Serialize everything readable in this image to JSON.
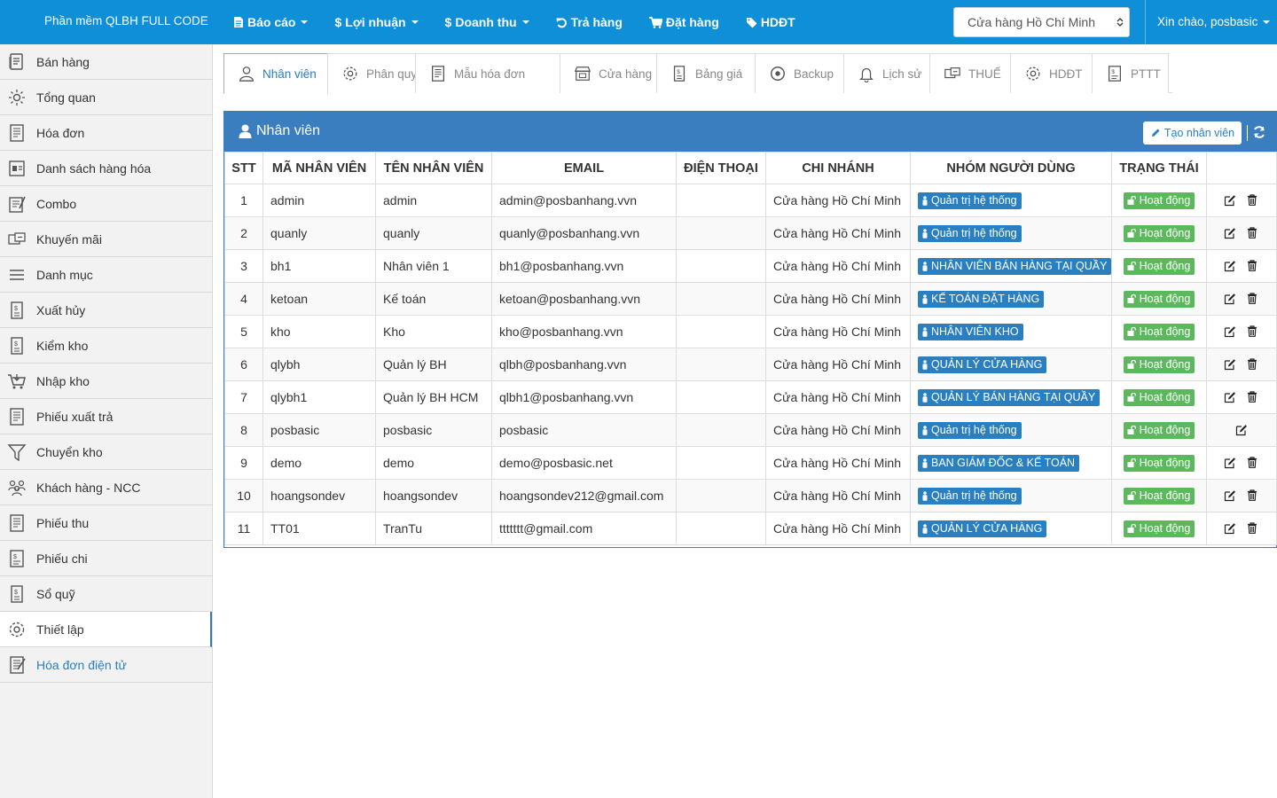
{
  "app": {
    "brand": "Phần mềm QLBH FULL CODE"
  },
  "topmenu": [
    {
      "icon": "file-text-icon",
      "label": "Báo cáo",
      "dropdown": true
    },
    {
      "icon": "dollar-icon",
      "label": "Lợi nhuận",
      "dropdown": true
    },
    {
      "icon": "dollar-icon",
      "label": "Doanh thu",
      "dropdown": true
    },
    {
      "icon": "undo-icon",
      "label": "Trả hàng",
      "dropdown": false
    },
    {
      "icon": "cart-icon",
      "label": "Đặt hàng",
      "dropdown": false
    },
    {
      "icon": "tag-icon",
      "label": "HDĐT",
      "dropdown": false
    }
  ],
  "store_select": {
    "value": "Cửa hàng Hồ Chí Minh"
  },
  "user": {
    "greeting": "Xin chào, posbasic"
  },
  "sidebar": [
    {
      "label": "Bán hàng",
      "icon": "sales-icon"
    },
    {
      "label": "Tổng quan",
      "icon": "dashboard-icon"
    },
    {
      "label": "Hóa đơn",
      "icon": "invoice-icon"
    },
    {
      "label": "Danh sách hàng hóa",
      "icon": "product-list-icon"
    },
    {
      "label": "Combo",
      "icon": "combo-icon"
    },
    {
      "label": "Khuyến mãi",
      "icon": "promotion-icon"
    },
    {
      "label": "Danh mục",
      "icon": "list-icon"
    },
    {
      "label": "Xuất hủy",
      "icon": "dispose-icon"
    },
    {
      "label": "Kiểm kho",
      "icon": "stock-check-icon"
    },
    {
      "label": "Nhập kho",
      "icon": "cart-in-icon"
    },
    {
      "label": "Phiếu xuất trả",
      "icon": "return-slip-icon"
    },
    {
      "label": "Chuyển kho",
      "icon": "filter-icon"
    },
    {
      "label": "Khách hàng - NCC",
      "icon": "customers-icon"
    },
    {
      "label": "Phiếu thu",
      "icon": "receipt-icon"
    },
    {
      "label": "Phiếu chi",
      "icon": "payment-icon"
    },
    {
      "label": "Sổ quỹ",
      "icon": "cashbook-icon"
    },
    {
      "label": "Thiết lập",
      "icon": "gear-icon",
      "active": true
    },
    {
      "label": "Hóa đơn điện tử",
      "icon": "e-invoice-icon",
      "link": true
    }
  ],
  "tabs": [
    {
      "label": "Nhân viên",
      "icon": "user-icon",
      "active": true,
      "width": 118
    },
    {
      "label": "Phân quyền",
      "icon": "gear-icon",
      "width": 100
    },
    {
      "label": "Mẫu hóa đơn",
      "icon": "invoice-icon",
      "width": 164
    },
    {
      "label": "Cửa hàng",
      "icon": "store-icon",
      "width": 110
    },
    {
      "label": "Bảng giá",
      "icon": "price-icon",
      "width": 112
    },
    {
      "label": "Backup",
      "icon": "backup-icon",
      "width": 101
    },
    {
      "label": "Lịch sử",
      "icon": "bell-icon",
      "width": 98
    },
    {
      "label": "THUẾ",
      "icon": "tax-icon",
      "width": 92
    },
    {
      "label": "HDĐT",
      "icon": "gear-icon",
      "width": 93
    },
    {
      "label": "PTTT",
      "icon": "payment-icon",
      "width": 87
    }
  ],
  "panel": {
    "title": "Nhân viên",
    "create_label": "Tạo nhân viên"
  },
  "table": {
    "headers": [
      "STT",
      "MÃ NHÂN VIÊN",
      "TÊN NHÂN VIÊN",
      "EMAIL",
      "ĐIỆN THOẠI",
      "CHI NHÁNH",
      "NHÓM NGƯỜI DÙNG",
      "TRẠNG THÁI",
      ""
    ],
    "rows": [
      {
        "stt": "1",
        "code": "admin",
        "name": "admin",
        "email": "admin@posbanhang.vvn",
        "phone": "",
        "branch": "Cửa hàng Hồ Chí Minh",
        "group": "Quản trị hệ thống",
        "status": "Hoạt động",
        "deletable": true
      },
      {
        "stt": "2",
        "code": "quanly",
        "name": "quanly",
        "email": "quanly@posbanhang.vvn",
        "phone": "",
        "branch": "Cửa hàng Hồ Chí Minh",
        "group": "Quản trị hệ thống",
        "status": "Hoạt động",
        "deletable": true
      },
      {
        "stt": "3",
        "code": "bh1",
        "name": "Nhân viên 1",
        "email": "bh1@posbanhang.vvn",
        "phone": "",
        "branch": "Cửa hàng Hồ Chí Minh",
        "group": "NHÂN VIÊN BÁN HÀNG TẠI QUẦY",
        "status": "Hoạt động",
        "deletable": true
      },
      {
        "stt": "4",
        "code": "ketoan",
        "name": "Kế toán",
        "email": "ketoan@posbanhang.vvn",
        "phone": "",
        "branch": "Cửa hàng Hồ Chí Minh",
        "group": "KẾ TOÁN ĐẶT HÀNG",
        "status": "Hoạt động",
        "deletable": true
      },
      {
        "stt": "5",
        "code": "kho",
        "name": "Kho",
        "email": "kho@posbanhang.vvn",
        "phone": "",
        "branch": "Cửa hàng Hồ Chí Minh",
        "group": "NHÂN VIÊN KHO",
        "status": "Hoạt động",
        "deletable": true
      },
      {
        "stt": "6",
        "code": "qlybh",
        "name": "Quản lý BH",
        "email": "qlbh@posbanhang.vvn",
        "phone": "",
        "branch": "Cửa hàng Hồ Chí Minh",
        "group": "QUẢN LÝ CỬA HÀNG",
        "status": "Hoạt động",
        "deletable": true
      },
      {
        "stt": "7",
        "code": "qlybh1",
        "name": "Quản lý BH HCM",
        "email": "qlbh1@posbanhang.vvn",
        "phone": "",
        "branch": "Cửa hàng Hồ Chí Minh",
        "group": "QUẢN LÝ BÁN HÀNG TẠI QUẦY",
        "status": "Hoạt động",
        "deletable": true
      },
      {
        "stt": "8",
        "code": "posbasic",
        "name": "posbasic",
        "email": "posbasic",
        "phone": "",
        "branch": "Cửa hàng Hồ Chí Minh",
        "group": "Quản trị hệ thống",
        "status": "Hoạt động",
        "deletable": false
      },
      {
        "stt": "9",
        "code": "demo",
        "name": "demo",
        "email": "demo@posbasic.net",
        "phone": "",
        "branch": "Cửa hàng Hồ Chí Minh",
        "group": "BAN GIÁM ĐỐC & KẾ TOÁN",
        "status": "Hoạt động",
        "deletable": true
      },
      {
        "stt": "10",
        "code": "hoangsondev",
        "name": "hoangsondev",
        "email": "hoangsondev212@gmail.com",
        "phone": "",
        "branch": "Cửa hàng Hồ Chí Minh",
        "group": "Quản trị hệ thống",
        "status": "Hoạt động",
        "deletable": true
      },
      {
        "stt": "11",
        "code": "TT01",
        "name": "TranTu",
        "email": "ttttttt@gmail.com",
        "phone": "",
        "branch": "Cửa hàng Hồ Chí Minh",
        "group": "QUẢN LÝ CỬA HÀNG",
        "status": "Hoạt động",
        "deletable": true
      }
    ]
  },
  "colors": {
    "navbar": "#0e8fd8",
    "panel_header": "#3a7ec0",
    "role_badge": "#2a7fc0",
    "status_badge": "#5cb85c"
  }
}
